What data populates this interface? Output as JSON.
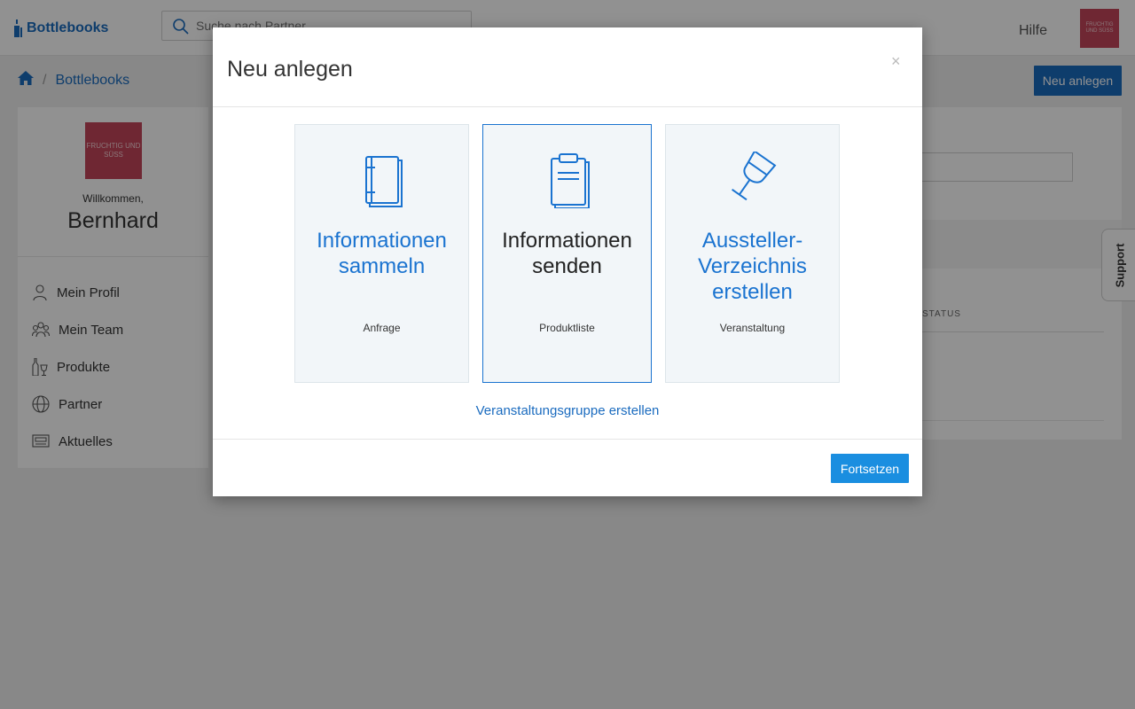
{
  "header": {
    "logo_text": "Bottlebooks",
    "search_placeholder": "Suche nach Partner",
    "help_label": "Hilfe",
    "avatar_text": "FRUCHTIG UND SÜSS"
  },
  "breadcrumb": {
    "home_icon": "home-icon",
    "items": [
      "Bottlebooks"
    ]
  },
  "new_button_label": "Neu anlegen",
  "sidebar": {
    "avatar_text": "FRUCHTIG UND SÜSS",
    "welcome": "Willkommen,",
    "username": "Bernhard",
    "items": [
      {
        "label": "Mein Profil",
        "icon": "user-icon"
      },
      {
        "label": "Mein Team",
        "icon": "team-icon"
      },
      {
        "label": "Produkte",
        "icon": "bottle-glass-icon"
      },
      {
        "label": "Partner",
        "icon": "globe-icon"
      },
      {
        "label": "Aktuelles",
        "icon": "news-icon"
      }
    ]
  },
  "main": {
    "status_header": "STATUS"
  },
  "support_label": "Support",
  "modal": {
    "title": "Neu anlegen",
    "close_symbol": "×",
    "options": [
      {
        "title_line1": "Informationen",
        "title_line2": "sammeln",
        "title_line3": "",
        "subtitle": "Anfrage",
        "icon": "notebook-icon",
        "selected": false
      },
      {
        "title_line1": "Informationen",
        "title_line2": "senden",
        "title_line3": "",
        "subtitle": "Produktliste",
        "icon": "clipboard-icon",
        "selected": true
      },
      {
        "title_line1": "Aussteller-",
        "title_line2": "Verzeichnis",
        "title_line3": "erstellen",
        "subtitle": "Veranstaltung",
        "icon": "wine-glass-icon",
        "selected": false
      }
    ],
    "group_link": "Veranstaltungsgruppe erstellen",
    "continue_label": "Fortsetzen"
  },
  "colors": {
    "accent": "#1a6bbf",
    "button_primary": "#1a8ee0",
    "avatar": "#c4465a",
    "card_bg": "#f2f6f9"
  }
}
